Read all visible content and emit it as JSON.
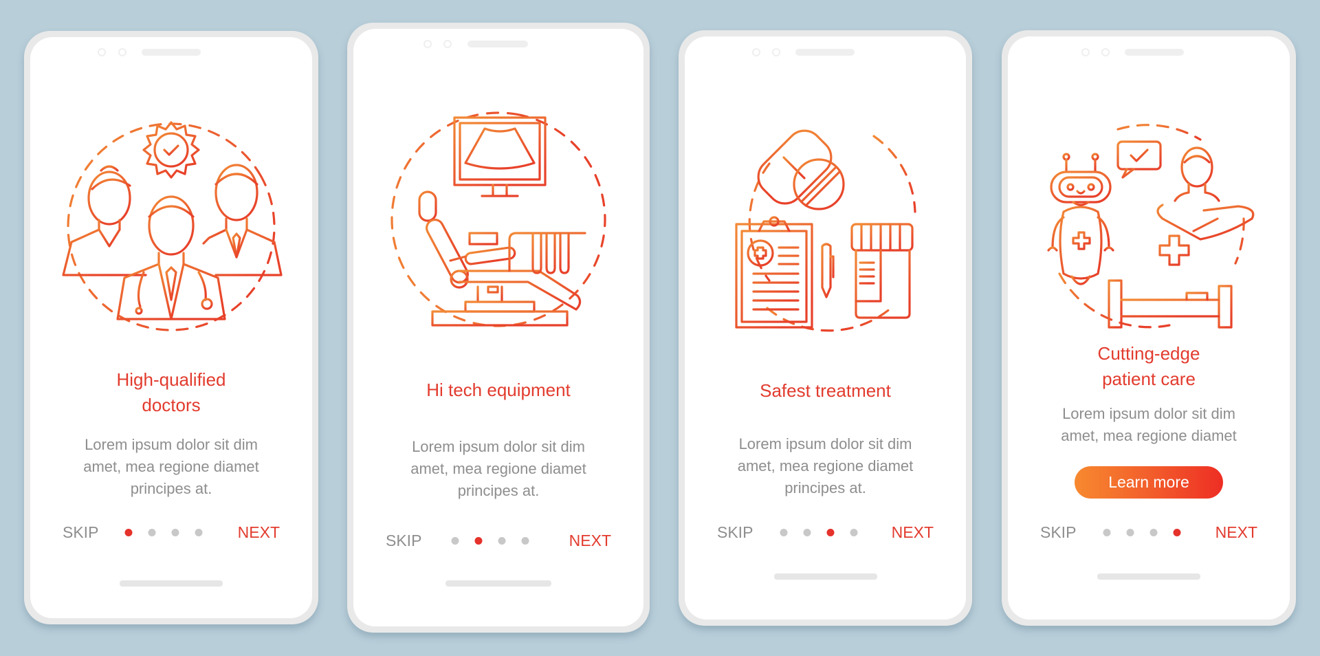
{
  "colors": {
    "background": "#B8CED9",
    "accent_red": "#E23B2E",
    "accent_orange": "#F7892F",
    "body_text": "#8E8E8E",
    "dot_inactive": "#C8C8C8",
    "dot_active": "#E5322B"
  },
  "screens": [
    {
      "icon": "doctors-team-icon",
      "title_lines": [
        "High-qualified",
        "doctors"
      ],
      "body_lines": [
        "Lorem ipsum dolor sit dim",
        "amet, mea regione diamet",
        "principes at."
      ],
      "skip_label": "SKIP",
      "next_label": "NEXT",
      "page_count": 4,
      "active_page": 1
    },
    {
      "icon": "ultrasound-equipment-icon",
      "title_lines": [
        "Hi tech equipment"
      ],
      "body_lines": [
        "Lorem ipsum dolor sit dim",
        "amet, mea regione diamet",
        "principes at."
      ],
      "skip_label": "SKIP",
      "next_label": "NEXT",
      "page_count": 4,
      "active_page": 2
    },
    {
      "icon": "medication-prescription-icon",
      "title_lines": [
        "Safest treatment"
      ],
      "body_lines": [
        "Lorem ipsum dolor sit dim",
        "amet, mea regione diamet",
        "principes at."
      ],
      "skip_label": "SKIP",
      "next_label": "NEXT",
      "page_count": 4,
      "active_page": 3
    },
    {
      "icon": "robot-patient-care-icon",
      "title_lines": [
        "Cutting-edge",
        "patient care"
      ],
      "body_lines": [
        "Lorem ipsum dolor sit dim",
        "amet, mea regione diamet"
      ],
      "cta_label": "Learn more",
      "skip_label": "SKIP",
      "next_label": "NEXT",
      "page_count": 4,
      "active_page": 4
    }
  ]
}
